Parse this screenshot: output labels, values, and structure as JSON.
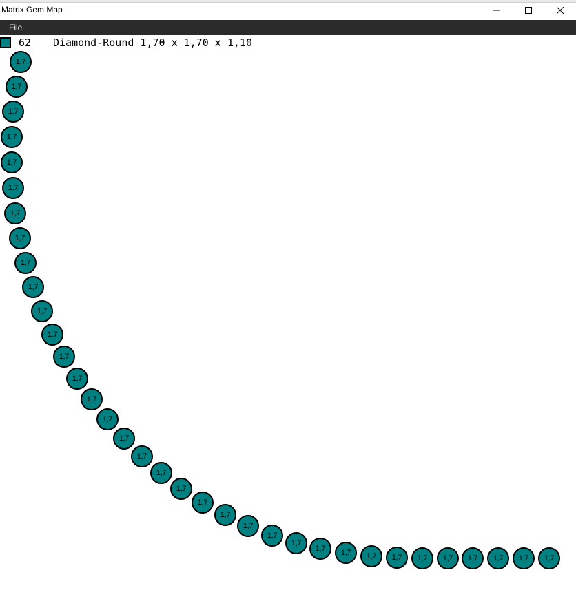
{
  "window": {
    "title": "Matrix Gem Map"
  },
  "menu": {
    "items": [
      {
        "label": "File"
      }
    ]
  },
  "legend": {
    "count": "62",
    "description": "Diamond-Round 1,70 x 1,70 x 1,10",
    "color": "#008080"
  },
  "gems": {
    "color": "#008080",
    "label": "1,7",
    "shape": "circle"
  },
  "icons": {
    "minimize": "minimize-icon",
    "maximize": "maximize-icon",
    "close": "close-icon"
  }
}
